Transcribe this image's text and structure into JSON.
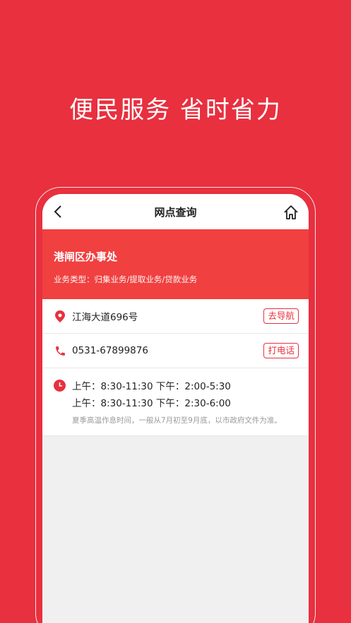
{
  "slogan": "便民服务  省时省力",
  "header": {
    "title": "网点查询",
    "back_icon": "chevron-left-icon",
    "home_icon": "home-icon"
  },
  "branch": {
    "name": "港闸区办事处",
    "business_type": "业务类型：归集业务/提取业务/贷款业务"
  },
  "address": {
    "text": "江海大道696号",
    "action_label": "去导航",
    "icon": "location-pin-icon"
  },
  "phone": {
    "text": "0531-67899876",
    "action_label": "打电话",
    "icon": "phone-icon"
  },
  "hours": {
    "icon": "clock-icon",
    "lines": [
      "上午：8:30-11:30  下午：2:00-5:30",
      "上午：8:30-11:30  下午：2:30-6:00"
    ],
    "note": "夏季高温作息时间，一般从7月初至9月底，以市政府文件为准。"
  },
  "colors": {
    "background": "#e8303f",
    "banner": "#f04040",
    "accent": "#e8303f"
  }
}
